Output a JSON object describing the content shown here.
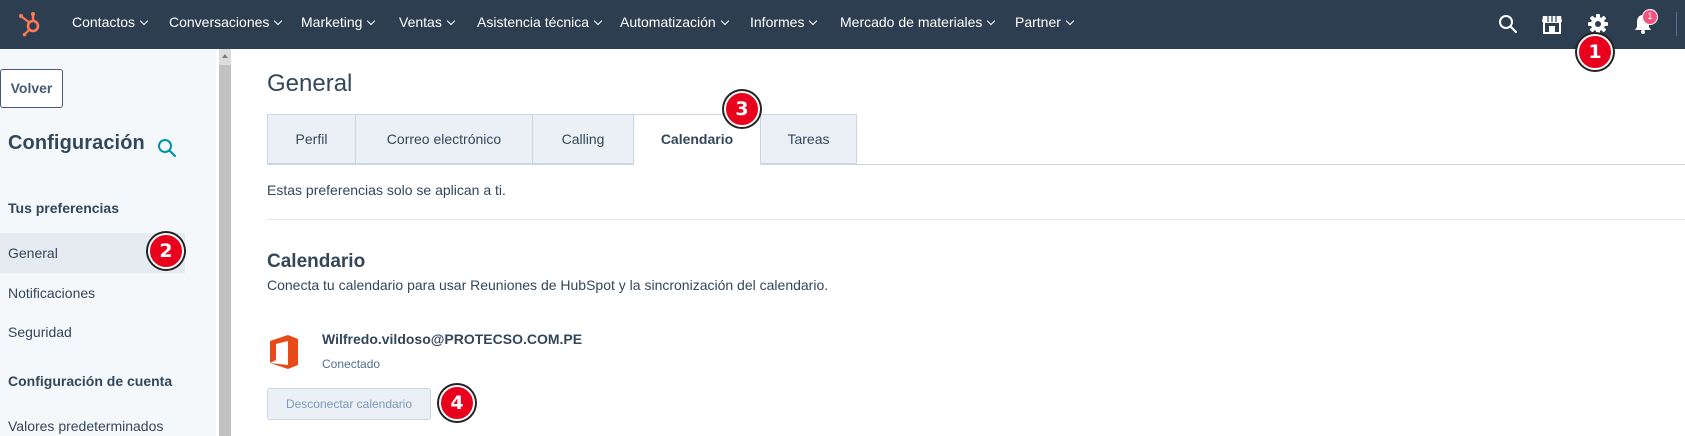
{
  "colors": {
    "nav_bg": "#2d3e50",
    "brand_orange": "#ff7a59",
    "callout_red": "#e8001c",
    "sidebar_bg": "#f5f8fa",
    "text": "#33475b"
  },
  "topnav": {
    "logo_icon": "hubspot-sprocket-icon",
    "items": [
      {
        "label": "Contactos"
      },
      {
        "label": "Conversaciones"
      },
      {
        "label": "Marketing"
      },
      {
        "label": "Ventas"
      },
      {
        "label": "Asistencia técnica"
      },
      {
        "label": "Automatización"
      },
      {
        "label": "Informes"
      },
      {
        "label": "Mercado de materiales"
      },
      {
        "label": "Partner"
      }
    ],
    "icons": [
      "search-icon",
      "marketplace-icon",
      "settings-gear-icon",
      "notifications-bell-icon"
    ],
    "notification_count": "1"
  },
  "sidebar": {
    "back_label": "Volver",
    "title": "Configuración",
    "sections": [
      {
        "heading": "Tus preferencias",
        "items": [
          {
            "label": "General",
            "active": true
          },
          {
            "label": "Notificaciones"
          },
          {
            "label": "Seguridad"
          }
        ]
      },
      {
        "heading": "Configuración de cuenta",
        "items": [
          {
            "label": "Valores predeterminados"
          }
        ]
      }
    ]
  },
  "main": {
    "title": "General",
    "tabs": [
      {
        "label": "Perfil"
      },
      {
        "label": "Correo electrónico"
      },
      {
        "label": "Calling"
      },
      {
        "label": "Calendario",
        "active": true
      },
      {
        "label": "Tareas"
      }
    ],
    "note": "Estas preferencias solo se aplican a ti.",
    "calendar": {
      "title": "Calendario",
      "description": "Conecta tu calendario para usar Reuniones de HubSpot y la sincronización del calendario.",
      "provider_icon": "microsoft-office-icon",
      "account": "Wilfredo.vildoso@PROTECSO.COM.PE",
      "status": "Conectado",
      "disconnect_label": "Desconectar calendario"
    }
  },
  "callouts": [
    "1",
    "2",
    "3",
    "4"
  ]
}
